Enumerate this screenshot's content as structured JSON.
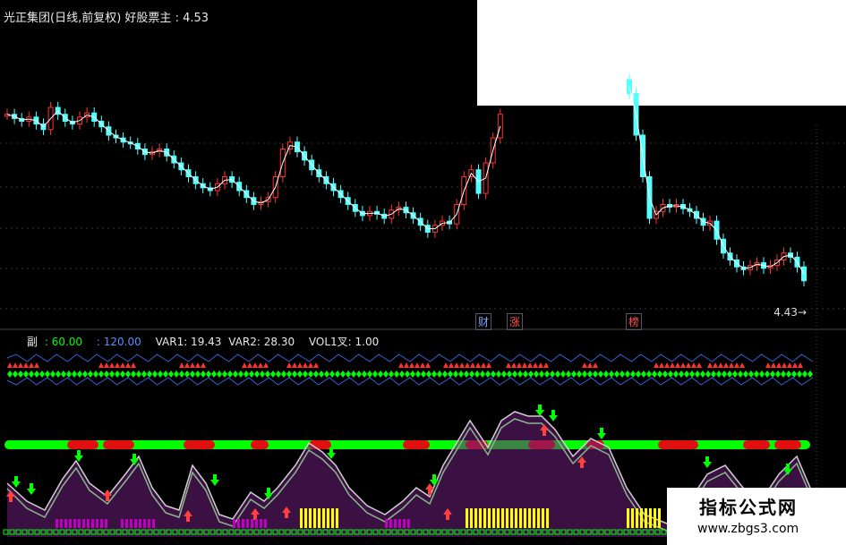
{
  "header": {
    "title": "光正集团(日线,前复权)",
    "indicator": "好股票主",
    "value": "4.53"
  },
  "indicator_bar": {
    "name": "副",
    "p1": ": 60.00",
    "p2": ": 120.00",
    "var1": "VAR1: 19.43",
    "var2": "VAR2: 28.30",
    "vol": "VOL1叉: 1.00"
  },
  "badges": {
    "cai": "财",
    "zhang": "涨",
    "bang": "榜"
  },
  "price_label": "4.43",
  "watermark": {
    "line1": "指标公式网",
    "line2": "www.zbgs3.com"
  },
  "colors": {
    "up": "#ff3232",
    "down": "#54ffff",
    "green": "#00ff00",
    "magenta": "#c000c0",
    "yellow": "#ffff00",
    "blue": "#3a5fd0"
  },
  "chart_data": {
    "type": "candlestick",
    "closes": [
      4.95,
      4.92,
      4.9,
      4.93,
      4.88,
      4.84,
      5.0,
      4.95,
      4.9,
      4.88,
      4.93,
      4.96,
      4.9,
      4.86,
      4.8,
      4.78,
      4.75,
      4.74,
      4.7,
      4.66,
      4.68,
      4.7,
      4.65,
      4.6,
      4.55,
      4.5,
      4.45,
      4.42,
      4.4,
      4.45,
      4.5,
      4.46,
      4.4,
      4.35,
      4.3,
      4.32,
      4.35,
      4.5,
      4.7,
      4.75,
      4.68,
      4.62,
      4.55,
      4.5,
      4.45,
      4.4,
      4.35,
      4.3,
      4.25,
      4.22,
      4.25,
      4.23,
      4.2,
      4.26,
      4.28,
      4.24,
      4.2,
      4.15,
      4.1,
      4.15,
      4.18,
      4.16,
      4.3,
      4.5,
      4.55,
      4.38,
      4.6,
      4.78,
      4.95
    ],
    "closes_after_gap": [
      5.1,
      4.8,
      4.5,
      4.2,
      4.25,
      4.3,
      4.28,
      4.3,
      4.27,
      4.25,
      4.2,
      4.15,
      4.18,
      4.05,
      3.95,
      3.9,
      3.85,
      3.83,
      3.86,
      3.88,
      3.84,
      3.86,
      3.9,
      3.95,
      3.92,
      3.85,
      3.75
    ]
  }
}
